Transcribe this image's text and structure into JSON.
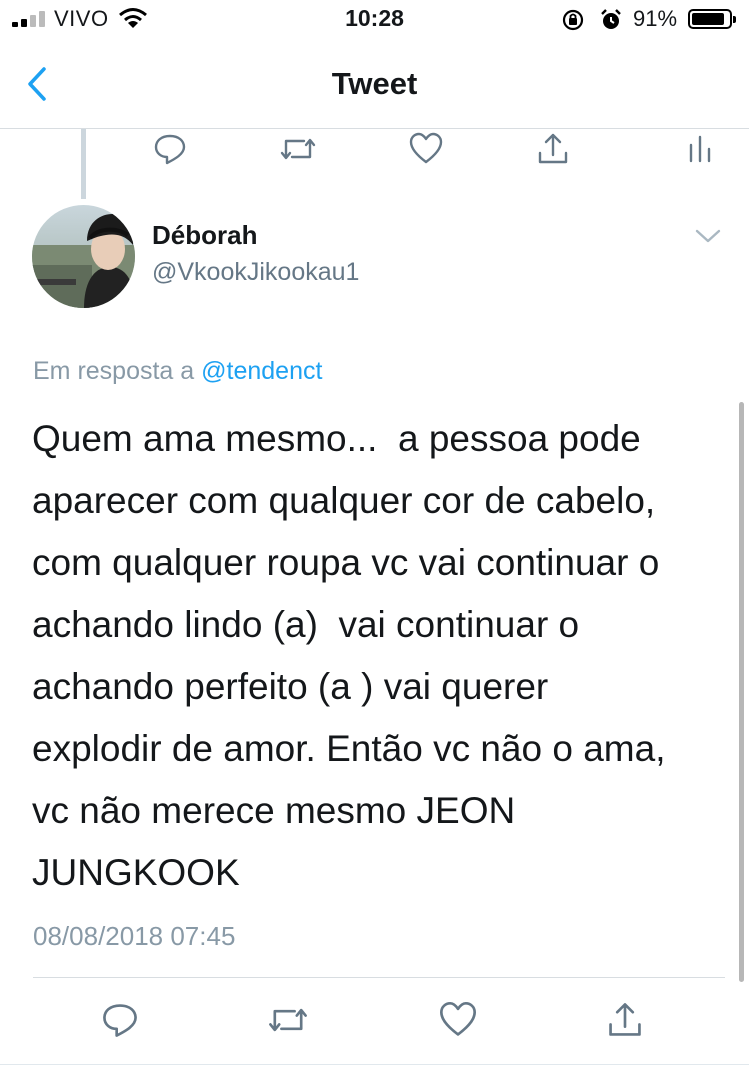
{
  "status_bar": {
    "carrier": "VIVO",
    "time": "10:28",
    "battery_percent": "91%",
    "battery_level": 0.91
  },
  "nav": {
    "title": "Tweet",
    "back_icon": "chevron-left-icon"
  },
  "parent_tweet_actions": [
    "reply-icon",
    "retweet-icon",
    "like-icon",
    "share-icon",
    "analytics-icon"
  ],
  "tweet": {
    "author_name": "Déborah",
    "author_handle": "@VkookJikookau1",
    "reply_prefix": "Em resposta a",
    "reply_to": "@tendenct",
    "lines": [
      "Quem ama mesmo...  a pessoa pode",
      "aparecer com qualquer cor de cabelo,",
      "com qualquer roupa vc vai continuar o",
      "achando lindo (a)  vai continuar o",
      "achando perfeito (a ) vai querer",
      "explodir de amor. Então vc não o ama,",
      "vc não merece mesmo JEON",
      "JUNGKOOK"
    ],
    "timestamp": "08/08/2018 07:45"
  },
  "actions": [
    "reply-icon",
    "retweet-icon",
    "like-icon",
    "share-icon"
  ],
  "colors": {
    "accent": "#1da1f2",
    "secondary_text": "#657786",
    "muted_text": "#8899a6",
    "icon": "#657786"
  }
}
